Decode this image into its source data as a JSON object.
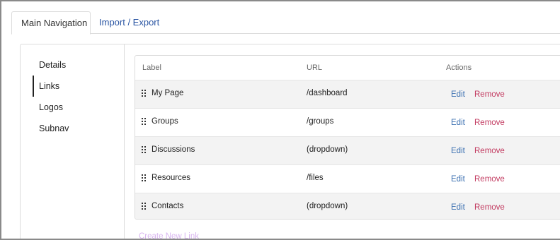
{
  "tabs": [
    {
      "label": "Main Navigation",
      "active": true
    },
    {
      "label": "Import / Export",
      "active": false
    }
  ],
  "subnav": {
    "items": [
      {
        "label": "Details",
        "active": false
      },
      {
        "label": "Links",
        "active": true
      },
      {
        "label": "Logos",
        "active": false
      },
      {
        "label": "Subnav",
        "active": false
      }
    ]
  },
  "table": {
    "columns": [
      "Label",
      "URL",
      "Actions"
    ],
    "rows": [
      {
        "label": "My Page",
        "url": "/dashboard",
        "edit": "Edit",
        "remove": "Remove"
      },
      {
        "label": "Groups",
        "url": "/groups",
        "edit": "Edit",
        "remove": "Remove"
      },
      {
        "label": "Discussions",
        "url": "(dropdown)",
        "edit": "Edit",
        "remove": "Remove"
      },
      {
        "label": "Resources",
        "url": "/files",
        "edit": "Edit",
        "remove": "Remove"
      },
      {
        "label": "Contacts",
        "url": "(dropdown)",
        "edit": "Edit",
        "remove": "Remove"
      }
    ]
  },
  "create_link": "Create New Link",
  "colors": {
    "tab_link": "#2a55a3",
    "edit": "#3a6fb0",
    "remove": "#c2395f",
    "create_link": "#d9b6f0",
    "row_alt": "#f3f3f3"
  },
  "icons": {
    "row_handle": "drag-handle-icon"
  }
}
